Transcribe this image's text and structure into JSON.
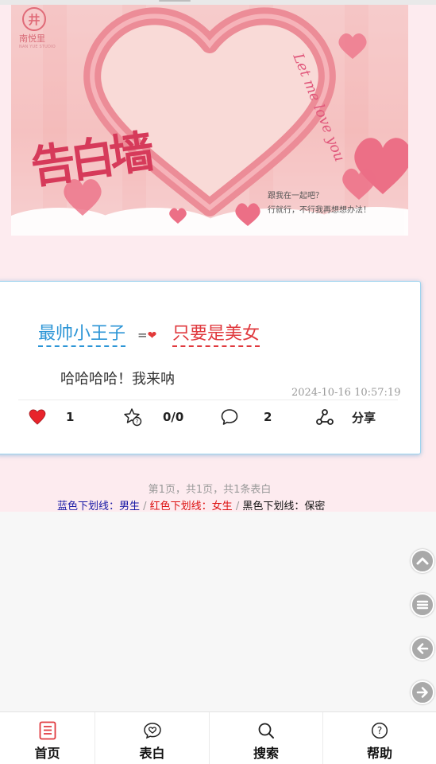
{
  "banner": {
    "brand_glyph": "井",
    "brand_name": "南悦里",
    "brand_sub": "NAN YUE STUDIO",
    "title": "告白墙",
    "script_text": "Let me love you",
    "note_line1": "跟我在一起吧？",
    "note_line2": "行就行，不行我再想想办法！"
  },
  "post": {
    "from": "最帅小王子",
    "arrow": "=",
    "to": "只要是美女",
    "message": "哈哈哈哈！我来呐",
    "timestamp": "2024-10-16 10:57:19",
    "likes": "1",
    "rating": "0/0",
    "comments": "2",
    "share_label": "分享",
    "colors": {
      "from": "#2c95d6",
      "to": "#e0393e"
    }
  },
  "pagination": {
    "text": "第1页，共1页，共1条表白"
  },
  "legend": {
    "blue": "蓝色下划线：男生",
    "sep1": " / ",
    "red": "红色下划线：女生",
    "sep2": " / ",
    "black": "黑色下划线：保密"
  },
  "side_buttons": [
    "chevron-up-icon",
    "menu-icon",
    "arrow-left-icon",
    "arrow-right-icon"
  ],
  "tabs": [
    {
      "label": "首页",
      "icon": "home-doc-icon"
    },
    {
      "label": "表白",
      "icon": "heart-bubble-icon"
    },
    {
      "label": "搜索",
      "icon": "search-icon"
    },
    {
      "label": "帮助",
      "icon": "help-icon"
    }
  ]
}
